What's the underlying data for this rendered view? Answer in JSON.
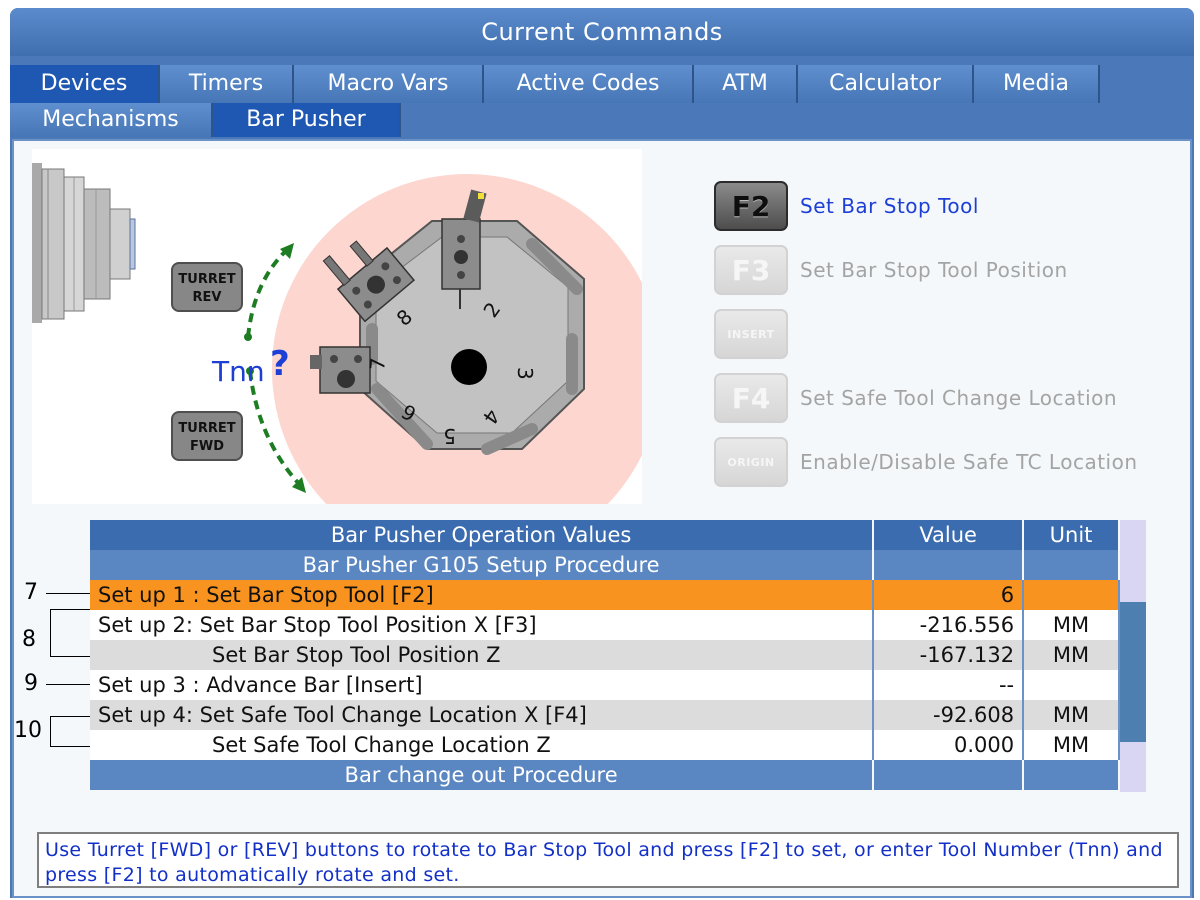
{
  "window": {
    "title": "Current Commands"
  },
  "tabs_row1": [
    "Devices",
    "Timers",
    "Macro Vars",
    "Active Codes",
    "ATM",
    "Calculator",
    "Media"
  ],
  "tabs_row2": [
    "Mechanisms",
    "Bar Pusher"
  ],
  "diagram": {
    "turret_rev": [
      "TURRET",
      "REV"
    ],
    "turret_fwd": [
      "TURRET",
      "FWD"
    ],
    "tool_prompt": "Tnn",
    "question": "?",
    "station_numbers": [
      "8",
      "2",
      "7",
      "3",
      "6",
      "4",
      "5"
    ]
  },
  "fkeys": [
    {
      "key": "F2",
      "label": "Set Bar Stop Tool",
      "enabled": true
    },
    {
      "key": "F3",
      "label": "Set Bar Stop Tool Position",
      "enabled": false
    },
    {
      "key": "INSERT",
      "label": "",
      "enabled": false
    },
    {
      "key": "F4",
      "label": "Set Safe Tool Change Location",
      "enabled": false
    },
    {
      "key": "ORIGIN",
      "label": "Enable/Disable Safe TC Location",
      "enabled": false
    }
  ],
  "table": {
    "headers": [
      "Bar Pusher Operation Values",
      "Value",
      "Unit"
    ],
    "section1": "Bar Pusher G105 Setup Procedure",
    "rows": [
      {
        "label": "Set up 1 : Set Bar Stop Tool [F2]",
        "value": "6",
        "unit": ""
      },
      {
        "label": "Set up 2: Set Bar Stop Tool Position X [F3]",
        "value": "-216.556",
        "unit": "MM"
      },
      {
        "label": "Set Bar Stop Tool Position Z",
        "value": "-167.132",
        "unit": "MM"
      },
      {
        "label": "Set up 3 : Advance Bar [Insert]",
        "value": "--",
        "unit": ""
      },
      {
        "label": "Set up 4: Set Safe Tool Change Location X [F4]",
        "value": "-92.608",
        "unit": "MM"
      },
      {
        "label": "Set Safe Tool Change Location Z",
        "value": "0.000",
        "unit": "MM"
      }
    ],
    "section2": "Bar change out Procedure"
  },
  "callouts": [
    "7",
    "8",
    "9",
    "10"
  ],
  "help_text": "Use Turret [FWD] or [REV] buttons to rotate to Bar Stop Tool and press [F2] to set, or enter Tool Number (Tnn) and press [F2] to automatically rotate and set.",
  "colors": {
    "highlight": "#f7931e",
    "header_blue": "#3b6cb0",
    "prompt_blue": "#1d3fd6"
  }
}
